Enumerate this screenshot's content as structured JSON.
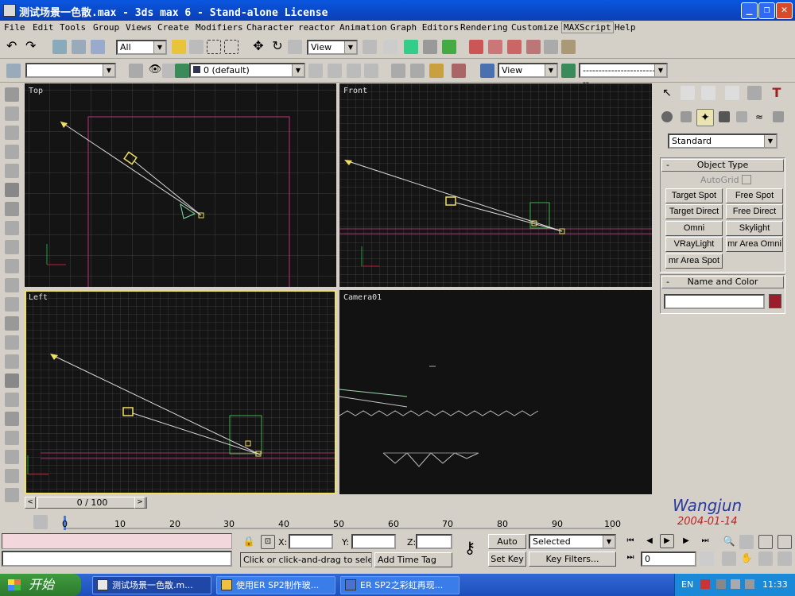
{
  "window": {
    "title": "测试场景一色散.max - 3ds max 6 - Stand-alone License",
    "controls": [
      "_",
      "❐",
      "✕"
    ]
  },
  "menu": [
    "File",
    "Edit",
    "Tools",
    "Group",
    "Views",
    "Create",
    "Modifiers",
    "Character",
    "reactor",
    "Animation",
    "Graph Editors",
    "Rendering",
    "Customize",
    "MAXScript",
    "Help"
  ],
  "toolbar": {
    "selection_filter": "All",
    "ref_coord": "View",
    "ref_coord2": "View",
    "layer": "0 (default)",
    "named_selection": "",
    "named_set": "----------------------------"
  },
  "viewports": {
    "top": {
      "label": "Top"
    },
    "front": {
      "label": "Front"
    },
    "left": {
      "label": "Left"
    },
    "camera": {
      "label": "Camera01"
    }
  },
  "panel": {
    "category_dropdown": "Standard",
    "object_type_title": "Object Type",
    "autogrid": "AutoGrid",
    "buttons": [
      "Target Spot",
      "Free Spot",
      "Target Direct",
      "Free Direct",
      "Omni",
      "Skylight",
      "VRayLight",
      "mr Area Omni",
      "mr Area Spot"
    ],
    "name_color_title": "Name and Color",
    "name_value": "",
    "rollout_minus": "-",
    "object_color": "#9b1c2a"
  },
  "timeline": {
    "frame_readout": "0 / 100",
    "ticks": [
      "0",
      "10",
      "20",
      "30",
      "40",
      "50",
      "60",
      "70",
      "80",
      "90",
      "100"
    ]
  },
  "status": {
    "x_label": "X:",
    "y_label": "Y:",
    "z_label": "Z:",
    "prompt": "Click or click-and-drag to select obj",
    "add_time_tag": "Add Time Tag",
    "auto_key": "Auto Key",
    "set_key": "Set Key",
    "selected_dropdown": "Selected",
    "key_filters": "Key Filters...",
    "current_frame": "0"
  },
  "watermark": {
    "name": "Wangjun",
    "date": "2004-01-14"
  },
  "taskbar": {
    "start": "开始",
    "tasks": [
      "测试场景一色散.m...",
      "使用ER SP2制作玻...",
      "ER SP2之彩虹再现..."
    ],
    "lang": "EN",
    "clock": "11:33"
  }
}
